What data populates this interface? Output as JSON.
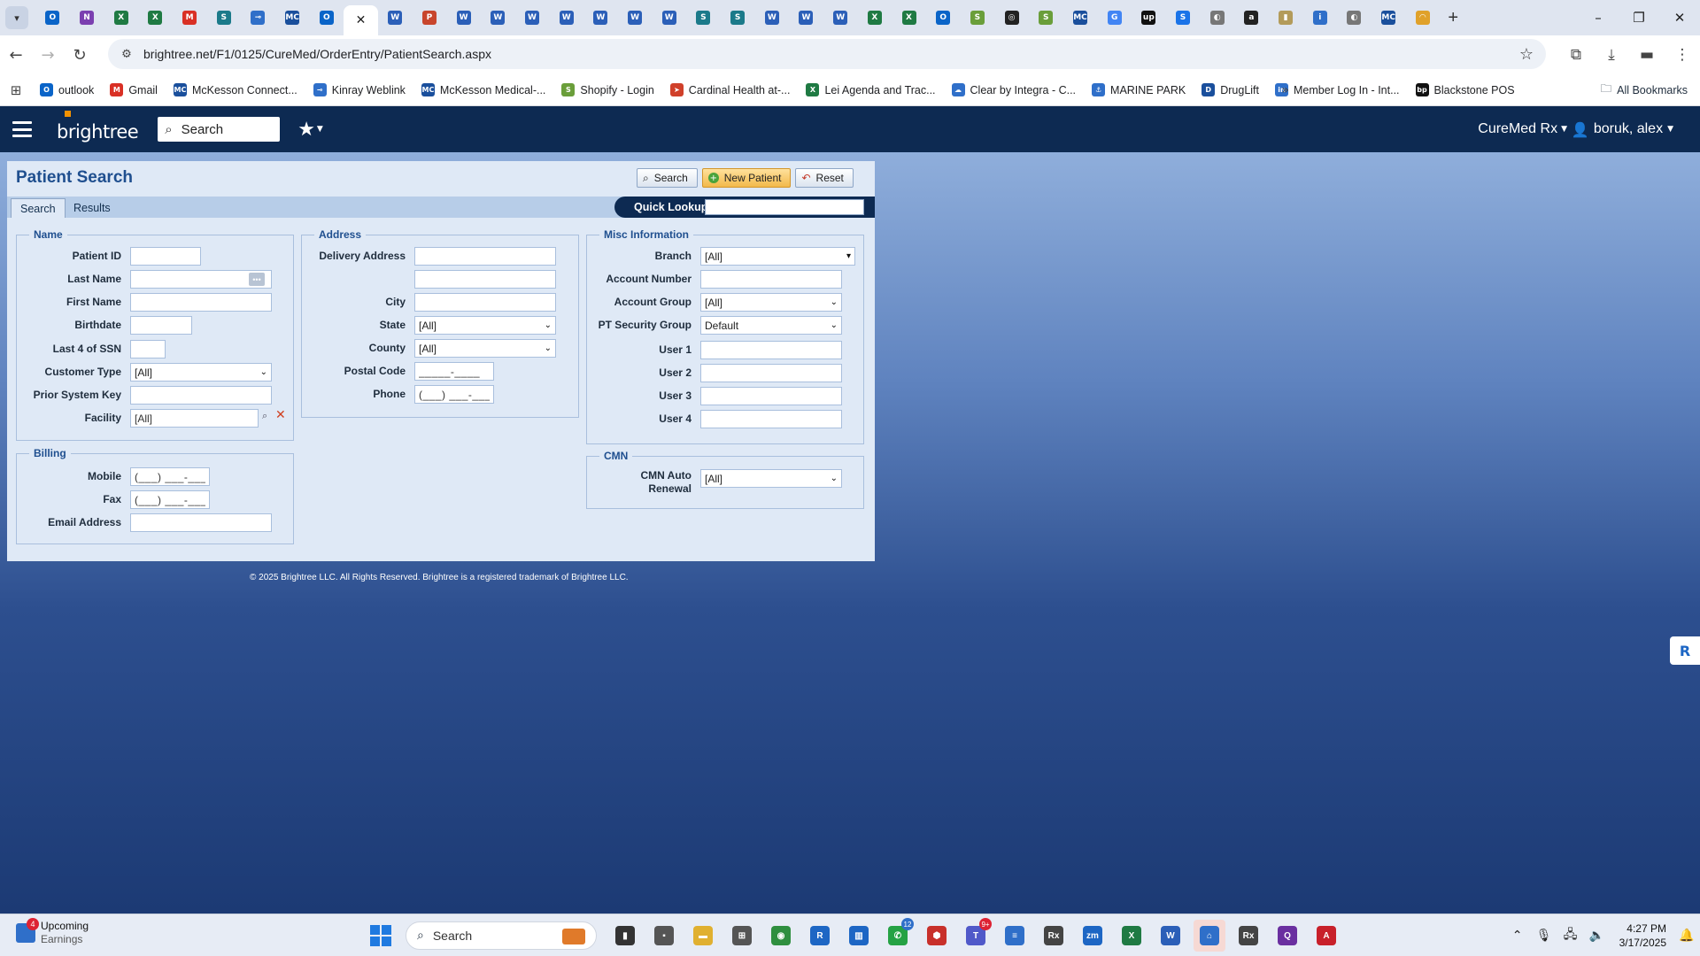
{
  "browser": {
    "tabs": [
      {
        "icon": "outlook-icon",
        "glyph": "O",
        "color": "#0a64c8"
      },
      {
        "icon": "onenote-icon",
        "glyph": "N",
        "color": "#7b3fb0"
      },
      {
        "icon": "excel-icon",
        "glyph": "X",
        "color": "#1f7a43"
      },
      {
        "icon": "excel-icon",
        "glyph": "X",
        "color": "#1f7a43"
      },
      {
        "icon": "gmail-icon",
        "glyph": "M",
        "color": "#d93025"
      },
      {
        "icon": "shopify-icon",
        "glyph": "S",
        "color": "#1b7a8a"
      },
      {
        "icon": "key-icon",
        "glyph": "⊸",
        "color": "#2f6fc9"
      },
      {
        "icon": "mckesson-icon",
        "glyph": "MC",
        "color": "#1a4f9c"
      },
      {
        "icon": "outlook-icon",
        "glyph": "O",
        "color": "#0a64c8"
      },
      {
        "icon": "brightree-icon",
        "glyph": "",
        "color": "#ffffff",
        "active": true
      },
      {
        "icon": "word-icon",
        "glyph": "W",
        "color": "#2b5fb8"
      },
      {
        "icon": "powerpoint-icon",
        "glyph": "P",
        "color": "#c8452c"
      },
      {
        "icon": "word-icon",
        "glyph": "W",
        "color": "#2b5fb8"
      },
      {
        "icon": "word-icon",
        "glyph": "W",
        "color": "#2b5fb8"
      },
      {
        "icon": "word-icon",
        "glyph": "W",
        "color": "#2b5fb8"
      },
      {
        "icon": "word-icon",
        "glyph": "W",
        "color": "#2b5fb8"
      },
      {
        "icon": "word-icon",
        "glyph": "W",
        "color": "#2b5fb8"
      },
      {
        "icon": "word-icon",
        "glyph": "W",
        "color": "#2b5fb8"
      },
      {
        "icon": "word-icon",
        "glyph": "W",
        "color": "#2b5fb8"
      },
      {
        "icon": "shopify-icon",
        "glyph": "S",
        "color": "#1b7a8a"
      },
      {
        "icon": "shopify-icon",
        "glyph": "S",
        "color": "#1b7a8a"
      },
      {
        "icon": "word-icon",
        "glyph": "W",
        "color": "#2b5fb8"
      },
      {
        "icon": "word-icon",
        "glyph": "W",
        "color": "#2b5fb8"
      },
      {
        "icon": "word-icon",
        "glyph": "W",
        "color": "#2b5fb8"
      },
      {
        "icon": "excel-icon",
        "glyph": "X",
        "color": "#1f7a43"
      },
      {
        "icon": "excel-icon",
        "glyph": "X",
        "color": "#1f7a43"
      },
      {
        "icon": "outlook-icon",
        "glyph": "O",
        "color": "#0a64c8"
      },
      {
        "icon": "shopify-bag-icon",
        "glyph": "S",
        "color": "#6a9e3a"
      },
      {
        "icon": "target-icon",
        "glyph": "◎",
        "color": "#222222"
      },
      {
        "icon": "shopify-bag-icon",
        "glyph": "S",
        "color": "#6a9e3a"
      },
      {
        "icon": "mckesson-icon",
        "glyph": "MC",
        "color": "#1a4f9c"
      },
      {
        "icon": "google-icon",
        "glyph": "G",
        "color": "#4285f4"
      },
      {
        "icon": "upwork-icon",
        "glyph": "up",
        "color": "#111111"
      },
      {
        "icon": "skype-icon",
        "glyph": "S",
        "color": "#1a73e8"
      },
      {
        "icon": "globe-icon",
        "glyph": "◐",
        "color": "#777777"
      },
      {
        "icon": "amazon-icon",
        "glyph": "a",
        "color": "#222222"
      },
      {
        "icon": "extension-icon",
        "glyph": "▮",
        "color": "#b39b5a"
      },
      {
        "icon": "info-icon",
        "glyph": "i",
        "color": "#2f6fc9"
      },
      {
        "icon": "globe-icon",
        "glyph": "◐",
        "color": "#777777"
      },
      {
        "icon": "mckesson-icon",
        "glyph": "MC",
        "color": "#1a4f9c"
      },
      {
        "icon": "rainbow-icon",
        "glyph": "◠",
        "color": "#e0a12a"
      }
    ],
    "url": "brightree.net/F1/0125/CureMed/OrderEntry/PatientSearch.aspx",
    "bookmarks": [
      {
        "label": "outlook",
        "icon": "outlook-icon",
        "glyph": "O",
        "color": "#0a64c8"
      },
      {
        "label": "Gmail",
        "icon": "gmail-icon",
        "glyph": "M",
        "color": "#d93025"
      },
      {
        "label": "McKesson Connect...",
        "icon": "mckesson-icon",
        "glyph": "MC",
        "color": "#1a4f9c"
      },
      {
        "label": "Kinray Weblink",
        "icon": "kinray-icon",
        "glyph": "⊸",
        "color": "#2f6fc9"
      },
      {
        "label": "McKesson Medical-...",
        "icon": "mckesson-icon",
        "glyph": "MC",
        "color": "#1a4f9c"
      },
      {
        "label": "Shopify - Login",
        "icon": "shopify-bag-icon",
        "glyph": "S",
        "color": "#6a9e3a"
      },
      {
        "label": "Cardinal Health at-...",
        "icon": "cardinal-icon",
        "glyph": "➤",
        "color": "#d0402a"
      },
      {
        "label": "Lei Agenda and Trac...",
        "icon": "excel-icon",
        "glyph": "X",
        "color": "#1f7a43"
      },
      {
        "label": "Clear by Integra - C...",
        "icon": "cloud-icon",
        "glyph": "☁",
        "color": "#2f6fc9"
      },
      {
        "label": "MARINE PARK",
        "icon": "marine-park-icon",
        "glyph": "⚓",
        "color": "#2f6fc9"
      },
      {
        "label": "DrugLift",
        "icon": "druglift-icon",
        "glyph": "D",
        "color": "#1a4f9c"
      },
      {
        "label": "Member Log In - Int...",
        "icon": "member-login-icon",
        "glyph": "in",
        "color": "#2f6fc9"
      },
      {
        "label": "Blackstone POS",
        "icon": "blackstone-icon",
        "glyph": "bp",
        "color": "#111111"
      }
    ],
    "all_bookmarks": "All Bookmarks"
  },
  "app": {
    "search_placeholder": "Search",
    "company": "CureMed Rx",
    "user": "boruk, alex"
  },
  "page": {
    "title": "Patient Search",
    "buttons": {
      "search": "Search",
      "new_patient": "New Patient",
      "reset": "Reset"
    },
    "tabs": {
      "search": "Search",
      "results": "Results"
    },
    "quick_lookup_label": "Quick Lookup",
    "name_section": {
      "legend": "Name",
      "patient_id": "Patient ID",
      "last_name": "Last Name",
      "first_name": "First Name",
      "birthdate": "Birthdate",
      "last4_ssn": "Last 4 of SSN",
      "customer_type": "Customer Type",
      "customer_type_value": "[All]",
      "prior_system_key": "Prior System Key",
      "facility": "Facility",
      "facility_value": "[All]"
    },
    "address_section": {
      "legend": "Address",
      "delivery_address": "Delivery Address",
      "city": "City",
      "state": "State",
      "state_value": "[All]",
      "county": "County",
      "county_value": "[All]",
      "postal_code": "Postal Code",
      "postal_code_mask": "_____-____",
      "phone": "Phone",
      "phone_mask": "(___) ___-____"
    },
    "misc_section": {
      "legend": "Misc Information",
      "branch": "Branch",
      "branch_value": "[All]",
      "account_number": "Account Number",
      "account_group": "Account Group",
      "account_group_value": "[All]",
      "pt_security_group": "PT Security Group",
      "pt_security_group_value": "Default",
      "user1": "User 1",
      "user2": "User 2",
      "user3": "User 3",
      "user4": "User 4"
    },
    "billing_section": {
      "legend": "Billing",
      "mobile": "Mobile",
      "mobile_mask": "(___) ___-____",
      "fax": "Fax",
      "fax_mask": "(___) ___-____",
      "email": "Email Address"
    },
    "cmn_section": {
      "legend": "CMN",
      "auto_renewal_line1": "CMN Auto",
      "auto_renewal_line2": "Renewal",
      "auto_renewal_value": "[All]"
    },
    "footer": "© 2025 Brightree LLC. All Rights Reserved. Brightree is a registered trademark of Brightree LLC."
  },
  "taskbar": {
    "weather_title": "Upcoming",
    "weather_sub": "Earnings",
    "weather_badge": "4",
    "search_placeholder": "Search",
    "apps": [
      {
        "icon": "task-view-icon",
        "glyph": "▮",
        "color": "#333333"
      },
      {
        "icon": "widgets-icon",
        "glyph": "▪",
        "color": "#555555"
      },
      {
        "icon": "file-explorer-icon",
        "glyph": "▬",
        "color": "#e0b030"
      },
      {
        "icon": "calculator-icon",
        "glyph": "⊞",
        "color": "#555555"
      },
      {
        "icon": "chrome-icon",
        "glyph": "◉",
        "color": "#2f8f3f"
      },
      {
        "icon": "rx-app-icon",
        "glyph": "R",
        "color": "#1d66c4"
      },
      {
        "icon": "trello-icon",
        "glyph": "▥",
        "color": "#1d66c4"
      },
      {
        "icon": "whatsapp-icon",
        "glyph": "✆",
        "color": "#25a244",
        "badge": "12"
      },
      {
        "icon": "security-icon",
        "glyph": "⬢",
        "color": "#c8302a"
      },
      {
        "icon": "teams-icon",
        "glyph": "T",
        "color": "#5059c9",
        "badge": "9+"
      },
      {
        "icon": "notepad-icon",
        "glyph": "≡",
        "color": "#2f6fc9"
      },
      {
        "icon": "pharmacy-rx-icon",
        "glyph": "Rx",
        "color": "#444444"
      },
      {
        "icon": "zoom-icon",
        "glyph": "zm",
        "color": "#1d66c4"
      },
      {
        "icon": "excel-icon",
        "glyph": "X",
        "color": "#1f7a43"
      },
      {
        "icon": "word-icon",
        "glyph": "W",
        "color": "#2b5fb8"
      },
      {
        "icon": "remote-desktop-icon",
        "glyph": "⌂",
        "color": "#2f6fc9",
        "active": true
      },
      {
        "icon": "pharmacy-rx-icon",
        "glyph": "Rx",
        "color": "#444444"
      },
      {
        "icon": "app-q-icon",
        "glyph": "Q",
        "color": "#6a2fa0"
      },
      {
        "icon": "acrobat-icon",
        "glyph": "A",
        "color": "#c8202a"
      }
    ],
    "time": "4:27 PM",
    "date": "3/17/2025"
  }
}
